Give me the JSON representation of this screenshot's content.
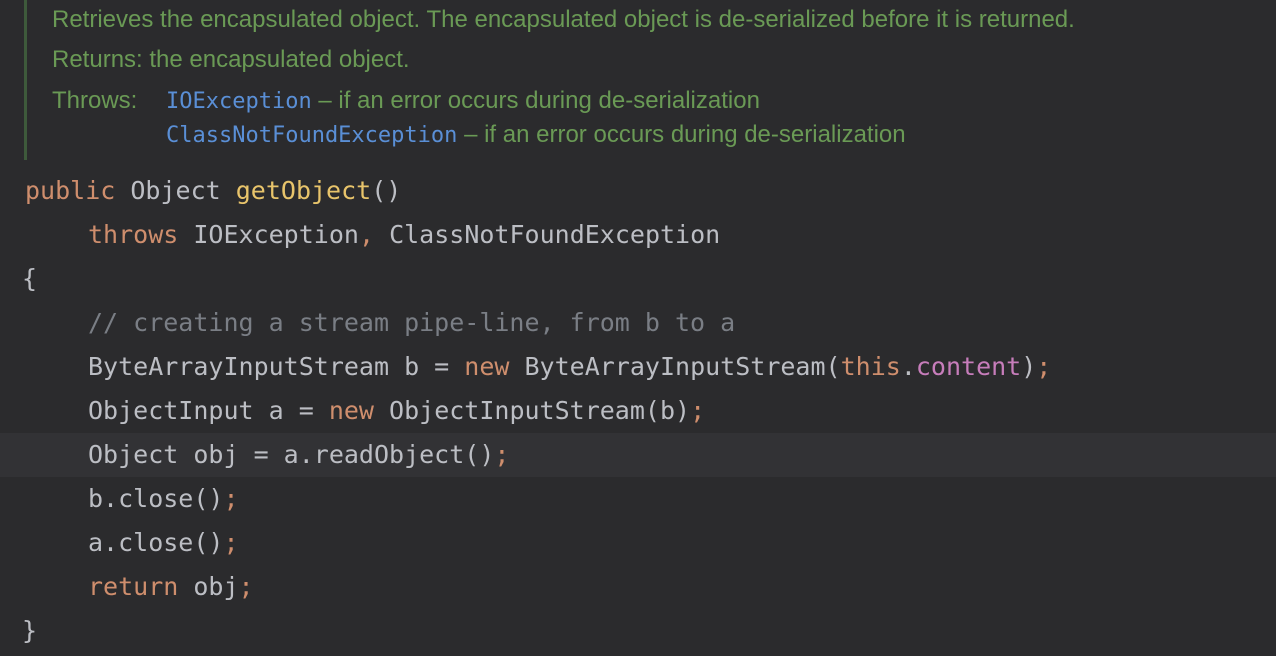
{
  "javadoc": {
    "description": "Retrieves the encapsulated object. The encapsulated object is de-serialized before it is returned.",
    "returns_label": "Returns:",
    "returns_text": "the encapsulated object.",
    "throws_label": "Throws:",
    "throws": [
      {
        "exception": "IOException",
        "text": "– if an error occurs during de-serialization"
      },
      {
        "exception": "ClassNotFoundException",
        "text": "– if an error occurs during de-serialization"
      }
    ]
  },
  "code": {
    "signature": {
      "modifier": "public",
      "return_type": "Object",
      "method_name": "getObject",
      "params": "()"
    },
    "throws_clause": {
      "keyword": "throws",
      "exceptions": "IOException",
      "comma": ",",
      "exception2": "ClassNotFoundException"
    },
    "open_brace": "{",
    "close_brace": "}",
    "comment": "// creating a stream pipe-line, from b to a",
    "line_bais": {
      "decl": "ByteArrayInputStream b = ",
      "new_kw": "new",
      "ctor": " ByteArrayInputStream(",
      "this_kw": "this",
      "dot": ".",
      "field": "content",
      "close": ")",
      "semi": ";"
    },
    "line_ois": {
      "decl": "ObjectInput a = ",
      "new_kw": "new",
      "ctor": " ObjectInputStream(b)",
      "semi": ";"
    },
    "line_read": {
      "text": "Object obj = a.readObject()",
      "semi": ";"
    },
    "line_bclose": {
      "text": "b.close()",
      "semi": ";"
    },
    "line_aclose": {
      "text": "a.close()",
      "semi": ";"
    },
    "line_return": {
      "kw": "return",
      "text": " obj",
      "semi": ";"
    }
  }
}
